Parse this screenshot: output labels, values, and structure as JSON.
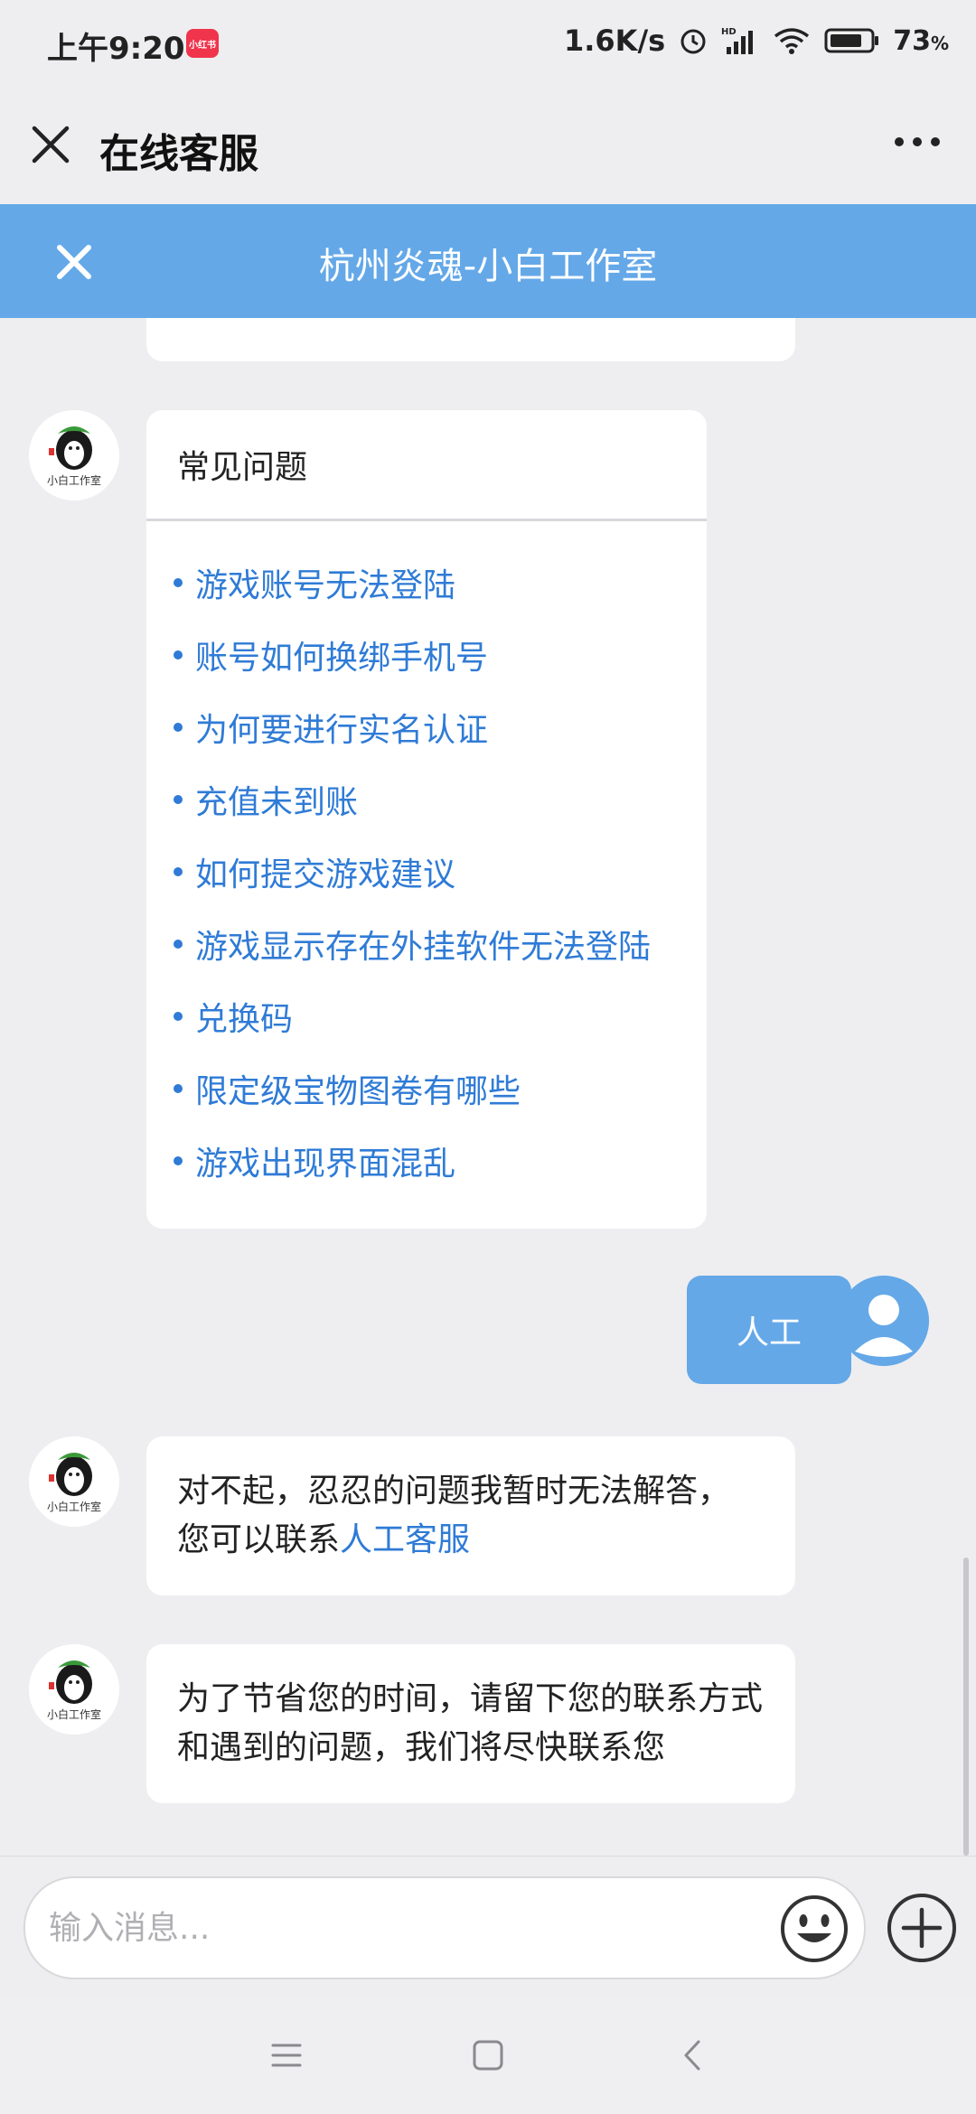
{
  "status_bar": {
    "time": "上午9:20",
    "app_badge": "小红书",
    "network_speed": "1.6K/s",
    "battery_percent": "73",
    "battery_suffix": "%"
  },
  "header": {
    "title": "在线客服"
  },
  "banner": {
    "title": "杭州炎魂-小白工作室"
  },
  "faq": {
    "heading": "常见问题",
    "items": [
      "游戏账号无法登陆",
      "账号如何换绑手机号",
      "为何要进行实名认证",
      "充值未到账",
      "如何提交游戏建议",
      "游戏显示存在外挂软件无法登陆",
      "兑换码",
      "限定级宝物图卷有哪些",
      "游戏出现界面混乱"
    ]
  },
  "messages": {
    "user_reply": "人工",
    "bot_sorry_text": "对不起，忍忍的问题我暂时无法解答，您可以联系",
    "bot_sorry_link": "人工客服",
    "bot_contact_text": "为了节省您的时间，请留下您的联系方式和遇到的问题，我们将尽快联系您"
  },
  "input": {
    "placeholder": "输入消息..."
  },
  "colors": {
    "accent_blue": "#64a8e8",
    "link_blue": "#2f7bd6",
    "background": "#eeeef0"
  }
}
